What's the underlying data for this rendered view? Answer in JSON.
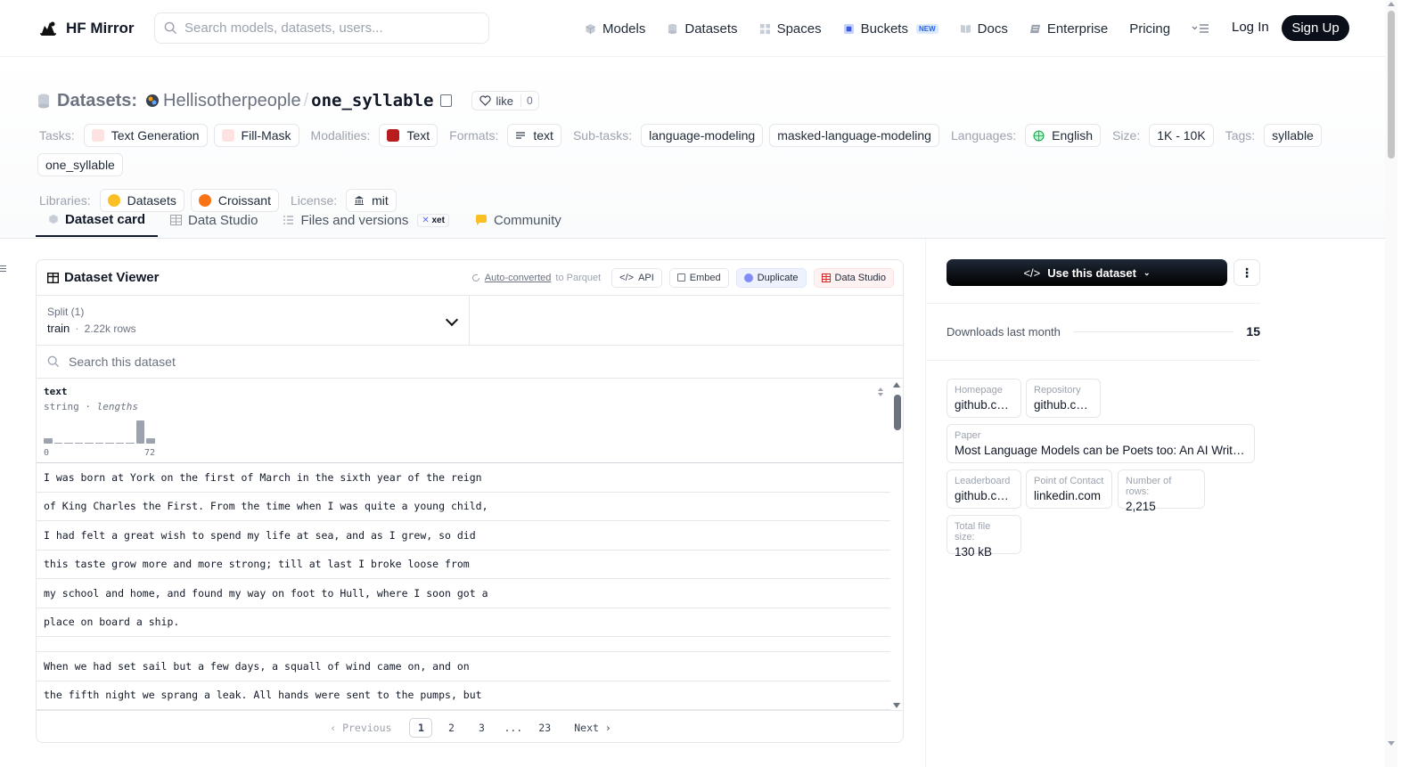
{
  "header": {
    "brand": "HF Mirror",
    "search_placeholder": "Search models, datasets, users...",
    "nav": [
      {
        "label": "Models",
        "icon": "cube-icon"
      },
      {
        "label": "Datasets",
        "icon": "database-icon"
      },
      {
        "label": "Spaces",
        "icon": "grid-icon"
      },
      {
        "label": "Buckets",
        "icon": "bucket-icon",
        "badge": "NEW"
      },
      {
        "label": "Docs",
        "icon": "book-icon"
      },
      {
        "label": "Enterprise",
        "icon": "enterprise-icon"
      },
      {
        "label": "Pricing"
      }
    ],
    "login": "Log In",
    "signup": "Sign Up"
  },
  "dataset": {
    "kind": "Datasets:",
    "owner": "Hellisotherpeople",
    "name": "one_syllable",
    "like_label": "like",
    "like_count": "0"
  },
  "tags": {
    "tasks_label": "Tasks:",
    "tasks": [
      "Text Generation",
      "Fill-Mask"
    ],
    "modalities_label": "Modalities:",
    "modalities": [
      "Text"
    ],
    "formats_label": "Formats:",
    "formats": [
      "text"
    ],
    "subtasks_label": "Sub-tasks:",
    "subtasks": [
      "language-modeling",
      "masked-language-modeling"
    ],
    "languages_label": "Languages:",
    "languages": [
      "English"
    ],
    "size_label": "Size:",
    "size": [
      "1K - 10K"
    ],
    "tags_label": "Tags:",
    "tags": [
      "syllable",
      "one_syllable"
    ],
    "libraries_label": "Libraries:",
    "libraries": [
      "Datasets",
      "Croissant"
    ],
    "license_label": "License:",
    "license": [
      "mit"
    ]
  },
  "tabs": {
    "card": "Dataset card",
    "studio": "Data Studio",
    "files": "Files and versions",
    "xet": "xet",
    "community": "Community"
  },
  "viewer": {
    "title": "Dataset Viewer",
    "autoconv_link": "Auto-converted",
    "autoconv_rest": "to Parquet",
    "api": "API",
    "embed": "Embed",
    "duplicate": "Duplicate",
    "data_studio": "Data Studio",
    "split_label": "Split (1)",
    "split_value": "train",
    "split_rows": "2.22k rows",
    "search_placeholder": "Search this dataset",
    "column_name": "text",
    "column_type": "string",
    "column_stat": "lengths",
    "hist_min": "0",
    "hist_max": "72",
    "hist_bins": [
      0.25,
      0.05,
      0.05,
      0.05,
      0.05,
      0.05,
      0.05,
      0.05,
      0.05,
      1.0,
      0.25
    ],
    "rows": [
      "I was born at York on the first of March in the sixth year of the reign",
      "of King Charles the First. From the time when I was quite a young child,",
      "I had felt a great wish to spend my life at sea, and as I grew, so did",
      "this taste grow more and more strong; till at last I broke loose from",
      "my school and home, and found my way on foot to Hull, where I soon got a",
      "place on board a ship.",
      "",
      "When we had set sail but a few days, a squall of wind came on, and on",
      "the fifth night we sprang a leak. All hands were sent to the pumps, but"
    ],
    "pager": {
      "prev": "Previous",
      "pages": [
        "1",
        "2",
        "3",
        "...",
        "23"
      ],
      "next": "Next"
    }
  },
  "sidebar": {
    "use_button": "Use this dataset",
    "downloads_label": "Downloads last month",
    "downloads_value": "15",
    "cards": [
      {
        "k": "Homepage",
        "v": "github.com"
      },
      {
        "k": "Repository",
        "v": "github.com"
      },
      {
        "k": "Paper",
        "v": "Most Language Models can be Poets too: An AI Writing Assistant and Constrained Text Generation Studio"
      },
      {
        "k": "Leaderboard",
        "v": "github.com"
      },
      {
        "k": "Point of Contact",
        "v": "linkedin.com"
      },
      {
        "k": "Number of rows:",
        "v": "2,215"
      },
      {
        "k": "Total file size:",
        "v": "130 kB"
      }
    ]
  }
}
